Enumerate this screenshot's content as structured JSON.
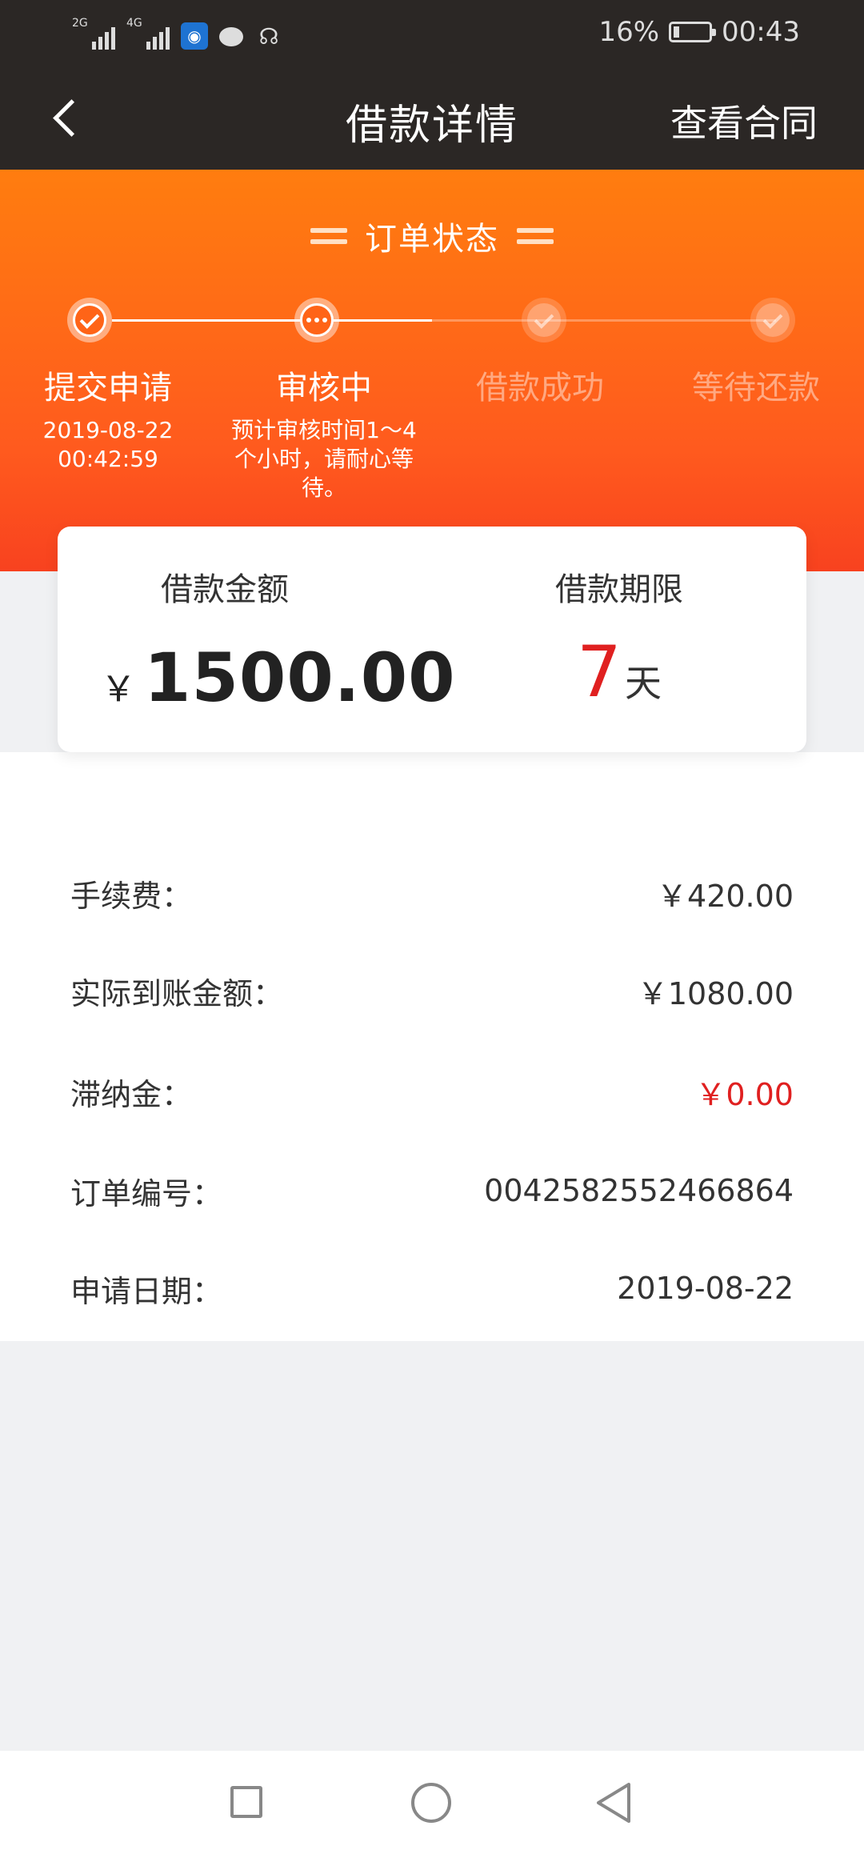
{
  "status_bar": {
    "signal_1_label": "2G",
    "signal_2_label": "4G",
    "icons": [
      "signal-icon",
      "signal-icon",
      "wifi-hotspot-icon",
      "chat-icon",
      "squirrel-icon"
    ],
    "battery_percent": "16%",
    "time": "00:43"
  },
  "nav": {
    "back_icon": "chevron-left-icon",
    "title": "借款详情",
    "contract_link": "查看合同"
  },
  "order_status": {
    "title": "订单状态",
    "steps": [
      {
        "label": "提交申请",
        "state": "done",
        "sub": "2019-08-22\n00:42:59"
      },
      {
        "label": "审核中",
        "state": "current",
        "sub": "预计审核时间1～4\n个小时，请耐心等\n待。"
      },
      {
        "label": "借款成功",
        "state": "pending",
        "sub": ""
      },
      {
        "label": "等待还款",
        "state": "pending",
        "sub": ""
      }
    ]
  },
  "loan_card": {
    "amount_label": "借款金额",
    "currency": "￥",
    "amount": "1500.00",
    "term_label": "借款期限",
    "term_value": "7",
    "term_unit": "天"
  },
  "details": [
    {
      "label": "手续费：",
      "value": "￥420.00",
      "highlight": false
    },
    {
      "label": "实际到账金额：",
      "value": "￥1080.00",
      "highlight": false
    },
    {
      "label": "滞纳金：",
      "value": "￥0.00",
      "highlight": true
    },
    {
      "label": "订单编号：",
      "value": "0042582552466864",
      "highlight": false
    },
    {
      "label": "申请日期：",
      "value": "2019-08-22",
      "highlight": false
    }
  ],
  "colors": {
    "topbar": "#2b2725",
    "hero_start": "#ff7d0f",
    "hero_end": "#f8421f",
    "accent_red": "#e02020",
    "page_bg": "#f0f1f3"
  },
  "system_nav": {
    "recent": "square-icon",
    "home": "circle-icon",
    "back": "triangle-back-icon"
  }
}
